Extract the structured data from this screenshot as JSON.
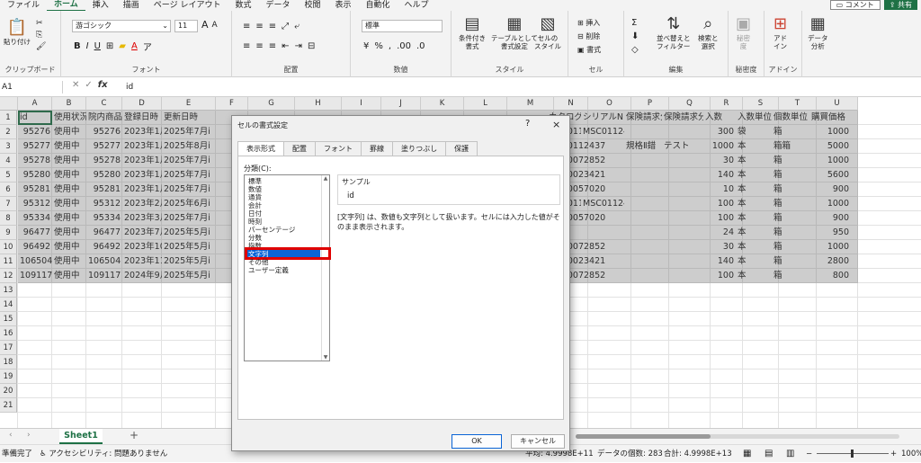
{
  "menu": [
    "ファイル",
    "ホーム",
    "挿入",
    "描画",
    "ページ レイアウト",
    "数式",
    "データ",
    "校閲",
    "表示",
    "自動化",
    "ヘルプ"
  ],
  "active_menu_index": 1,
  "top_buttons": {
    "comment": "コメント",
    "share": "共有"
  },
  "ribbon": {
    "clipboard": {
      "paste": "貼り付け",
      "label": "クリップボード"
    },
    "font": {
      "name": "游ゴシック",
      "size": "11",
      "grow": "A",
      "shrink": "A",
      "label": "フォント"
    },
    "alignment": {
      "label": "配置"
    },
    "number": {
      "format": "標準",
      "label": "数値"
    },
    "styles": {
      "conditional": "条件付き\n書式",
      "table": "テーブルとして\n書式設定",
      "cell_style": "セルの\nスタイル",
      "label": "スタイル"
    },
    "cells": {
      "insert": "挿入",
      "delete": "削除",
      "format": "書式",
      "label": "セル"
    },
    "editing": {
      "sort": "並べ替えと\nフィルター",
      "find": "検索と\n選択",
      "label": "編集"
    },
    "sensitivity": {
      "btn": "秘密\n度",
      "label": "秘密度"
    },
    "addins": {
      "btn": "アド\nイン",
      "label": "アドイン"
    },
    "analysis": {
      "btn": "データ\n分析"
    }
  },
  "formula_bar": {
    "name_box": "A1",
    "fx": "fx",
    "content": "id"
  },
  "columns": [
    "A",
    "B",
    "C",
    "D",
    "E",
    "F",
    "G",
    "H",
    "I",
    "J",
    "K",
    "L",
    "M",
    "N",
    "O",
    "P",
    "Q",
    "R",
    "S",
    "T",
    "U"
  ],
  "rows": [
    "1",
    "2",
    "3",
    "4",
    "5",
    "6",
    "7",
    "8",
    "9",
    "10",
    "11",
    "12",
    "13",
    "14",
    "15",
    "16",
    "17",
    "18",
    "19",
    "20",
    "21"
  ],
  "left_cells": [
    [
      "id",
      "使用状況",
      "院内商品Il",
      "登録日時",
      "更新日時"
    ],
    [
      "95276",
      "使用中",
      "95276",
      "2023年1月",
      "2025年7月i"
    ],
    [
      "95277",
      "使用中",
      "95277",
      "2023年1月",
      "2025年8月i"
    ],
    [
      "95278",
      "使用中",
      "95278",
      "2023年1月",
      "2025年7月i"
    ],
    [
      "95280",
      "使用中",
      "95280",
      "2023年1月",
      "2025年7月i"
    ],
    [
      "95281",
      "使用中",
      "95281",
      "2023年1月",
      "2025年7月i"
    ],
    [
      "95312",
      "使用中",
      "95312",
      "2023年2月",
      "2025年6月i"
    ],
    [
      "95334",
      "使用中",
      "95334",
      "2023年3月",
      "2025年7月i"
    ],
    [
      "96477",
      "使用中",
      "96477",
      "2023年7月",
      "2025年5月i"
    ],
    [
      "96492",
      "使用中",
      "96492",
      "2023年10",
      "2025年5月i"
    ],
    [
      "106504",
      "使用中",
      "106504",
      "2023年11",
      "2025年5月i"
    ],
    [
      "109117",
      "使用中",
      "109117",
      "2024年9月",
      "2025年5月i"
    ]
  ],
  "right_cells": [
    [
      "カタログN",
      "シリアルN",
      "保険請求分",
      "保険請求分",
      "入数",
      "入数単位",
      "個数単位",
      "購買価格"
    ],
    [
      "MSC0112",
      "MSC0112435",
      "",
      "",
      "300",
      "袋",
      "箱",
      "1000"
    ],
    [
      "MSC0112437",
      "",
      "規格Ⅱ錯",
      "テスト",
      "1000",
      "本",
      "箱箱",
      "5000"
    ],
    [
      "MSC0072852",
      "",
      "",
      "",
      "30",
      "本",
      "箱",
      "1000"
    ],
    [
      "MSC0023421",
      "",
      "",
      "",
      "140",
      "本",
      "箱",
      "5600"
    ],
    [
      "MSC0057020",
      "",
      "",
      "",
      "10",
      "本",
      "箱",
      "900"
    ],
    [
      "MSC0112",
      "MSC0112435",
      "",
      "",
      "100",
      "本",
      "箱",
      "1000"
    ],
    [
      "MSC0057020",
      "",
      "",
      "",
      "100",
      "本",
      "箱",
      "900"
    ],
    [
      "",
      "",
      "",
      "",
      "24",
      "本",
      "箱",
      "950"
    ],
    [
      "MSC0072852",
      "",
      "",
      "",
      "30",
      "本",
      "箱",
      "1000"
    ],
    [
      "MSC0023421",
      "",
      "",
      "",
      "140",
      "本",
      "箱",
      "2800"
    ],
    [
      "MSC0072852",
      "",
      "",
      "",
      "100",
      "本",
      "箱",
      "800"
    ]
  ],
  "sheet_tab": "Sheet1",
  "status": {
    "ready": "準備完了",
    "accessibility": "アクセシビリティ: 問題ありません",
    "avg": "平均: 4.9998E+11",
    "count": "データの個数: 283",
    "sum": "合計: 4.9998E+13",
    "zoom": "100%"
  },
  "dialog": {
    "title": "セルの書式設定",
    "help": "?",
    "close": "×",
    "tabs": [
      "表示形式",
      "配置",
      "フォント",
      "罫線",
      "塗りつぶし",
      "保護"
    ],
    "selected_tab_index": 0,
    "category_label": "分類(C):",
    "categories": [
      "標準",
      "数値",
      "通貨",
      "会計",
      "日付",
      "時刻",
      "パーセンテージ",
      "分数",
      "指数",
      "文字列",
      "その他",
      "ユーザー定義"
    ],
    "selected_category_index": 9,
    "sample_label": "サンプル",
    "sample_value": "id",
    "description": "[文字列] は、数値も文字列として扱います。セルには入力した値がそのまま表示されます。",
    "ok": "OK",
    "cancel": "キャンセル"
  }
}
